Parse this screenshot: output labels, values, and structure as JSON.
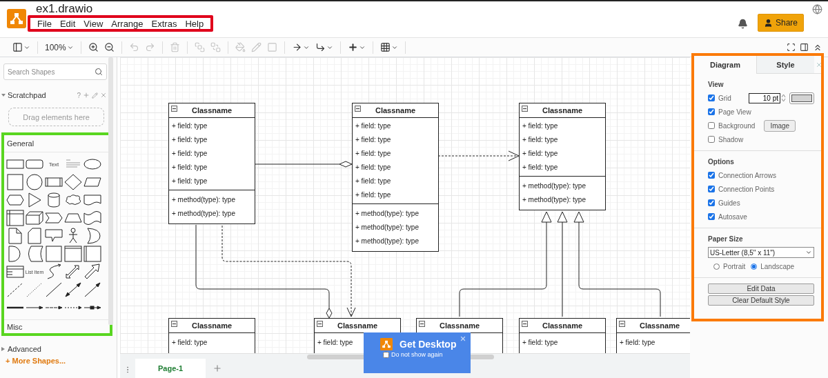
{
  "app": {
    "title": "ex1.drawio",
    "menu": [
      "File",
      "Edit",
      "View",
      "Arrange",
      "Extras",
      "Help"
    ],
    "share": "Share"
  },
  "toolbar": {
    "groups": [
      [
        {
          "kind": "layout",
          "disabled": false
        }
      ],
      [
        {
          "kind": "zoom",
          "label": "100%",
          "disabled": false
        }
      ],
      [
        {
          "kind": "zoom-in",
          "disabled": false
        },
        {
          "kind": "zoom-out",
          "disabled": false
        }
      ],
      [
        {
          "kind": "undo",
          "disabled": true
        },
        {
          "kind": "redo",
          "disabled": true
        }
      ],
      [
        {
          "kind": "delete",
          "disabled": true
        }
      ],
      [
        {
          "kind": "to-front",
          "disabled": true
        },
        {
          "kind": "to-back",
          "disabled": true
        }
      ],
      [
        {
          "kind": "fill",
          "disabled": true
        },
        {
          "kind": "line-color",
          "disabled": true
        },
        {
          "kind": "shadow",
          "disabled": true
        }
      ],
      [
        {
          "kind": "connection",
          "disabled": false
        },
        {
          "kind": "waypoints",
          "disabled": false
        }
      ],
      [
        {
          "kind": "insert",
          "disabled": false
        }
      ],
      [
        {
          "kind": "table",
          "disabled": false
        }
      ]
    ]
  },
  "sidebar": {
    "search": {
      "placeholder": "Search Shapes"
    },
    "scratchpad": {
      "title": "Scratchpad",
      "expanded": true,
      "help": "?",
      "drop_hint": "Drag elements here"
    },
    "general": {
      "title": "General",
      "expanded": true,
      "shapes": [
        {
          "kind": "rectangle"
        },
        {
          "kind": "rounded"
        },
        {
          "kind": "text",
          "label": "Text"
        },
        {
          "kind": "textbox"
        },
        {
          "kind": "ellipse"
        },
        {
          "kind": "square"
        },
        {
          "kind": "circle"
        },
        {
          "kind": "process"
        },
        {
          "kind": "diamond"
        },
        {
          "kind": "parallelogram"
        },
        {
          "kind": "hexagon"
        },
        {
          "kind": "triangle"
        },
        {
          "kind": "cylinder"
        },
        {
          "kind": "cloud"
        },
        {
          "kind": "document"
        },
        {
          "kind": "internal-storage"
        },
        {
          "kind": "cube"
        },
        {
          "kind": "step"
        },
        {
          "kind": "trapezoid"
        },
        {
          "kind": "tape"
        },
        {
          "kind": "note"
        },
        {
          "kind": "card"
        },
        {
          "kind": "callout"
        },
        {
          "kind": "actor"
        },
        {
          "kind": "crescent"
        },
        {
          "kind": "delay"
        },
        {
          "kind": "data-storage"
        },
        {
          "kind": "square"
        },
        {
          "kind": "container"
        },
        {
          "kind": "side-container"
        },
        {
          "kind": "list"
        },
        {
          "kind": "text",
          "label": "List Item"
        },
        {
          "kind": "curve"
        },
        {
          "kind": "double-arrow"
        },
        {
          "kind": "fat-arrow"
        },
        {
          "kind": "dashed-line"
        },
        {
          "kind": "dotted-line"
        },
        {
          "kind": "line"
        },
        {
          "kind": "bidirectional-line"
        },
        {
          "kind": "directional-line"
        },
        {
          "kind": "thick-line"
        },
        {
          "kind": "connector"
        },
        {
          "kind": "thin-connector"
        },
        {
          "kind": "dashed-connector"
        },
        {
          "kind": "link-connector"
        }
      ]
    },
    "sections": [
      {
        "title": "Misc"
      },
      {
        "title": "Advanced",
        "expanded": false
      }
    ],
    "more_shapes": "+ More Shapes..."
  },
  "diagram": {
    "classes": [
      {
        "name": "Classname",
        "fields": [
          "+ field: type",
          "+ field: type",
          "+ field: type",
          "+ field: type",
          "+ field: type"
        ],
        "methods": [
          "+ method(type): type",
          "+ method(type): type"
        ]
      },
      {
        "name": "Classname",
        "fields": [
          "+ field: type",
          "+ field: type",
          "+ field: type",
          "+ field: type",
          "+ field: type",
          "+ field: type"
        ],
        "methods": [
          "+ method(type): type",
          "+ method(type): type",
          "+ method(type): type"
        ]
      },
      {
        "name": "Classname",
        "fields": [
          "+ field: type",
          "+ field: type",
          "+ field: type",
          "+ field: type"
        ],
        "methods": [
          "+ method(type): type",
          "+ method(type): type"
        ]
      },
      {
        "name": "Classname",
        "fields": [
          "+ field: type"
        ]
      },
      {
        "name": "Classname",
        "fields": [
          "+ field: type"
        ]
      },
      {
        "name": "Classname"
      },
      {
        "name": "Classname",
        "fields": [
          "+ field: type"
        ]
      },
      {
        "name": "Classname",
        "fields": [
          "+ field: type"
        ]
      }
    ]
  },
  "pages": [
    {
      "label": "Page-1",
      "selected": true
    }
  ],
  "popup": {
    "title": "Get Desktop",
    "checkbox": {
      "label": "Do not show again",
      "checked": false
    }
  },
  "format_panel": {
    "tabs": [
      {
        "label": "Diagram",
        "selected": true
      },
      {
        "label": "Style",
        "selected": false
      }
    ],
    "view": {
      "title": "View",
      "items": [
        {
          "kind": "grid",
          "label": "Grid",
          "checked": true,
          "value": "10 pt"
        },
        {
          "kind": "plain",
          "label": "Page View",
          "checked": true
        },
        {
          "kind": "background",
          "label": "Background",
          "checked": false,
          "button": "Image"
        },
        {
          "kind": "plain",
          "label": "Shadow",
          "checked": false
        }
      ]
    },
    "options": {
      "title": "Options",
      "items": [
        {
          "label": "Connection Arrows",
          "checked": true
        },
        {
          "label": "Connection Points",
          "checked": true
        },
        {
          "label": "Guides",
          "checked": true
        },
        {
          "label": "Autosave",
          "checked": true
        }
      ]
    },
    "paper": {
      "title": "Paper Size",
      "value": "US-Letter (8,5\" x 11\")",
      "orientations": [
        {
          "label": "Portrait",
          "selected": false
        },
        {
          "label": "Landscape",
          "selected": true
        }
      ]
    },
    "buttons": [
      "Edit Data",
      "Clear Default Style"
    ]
  }
}
